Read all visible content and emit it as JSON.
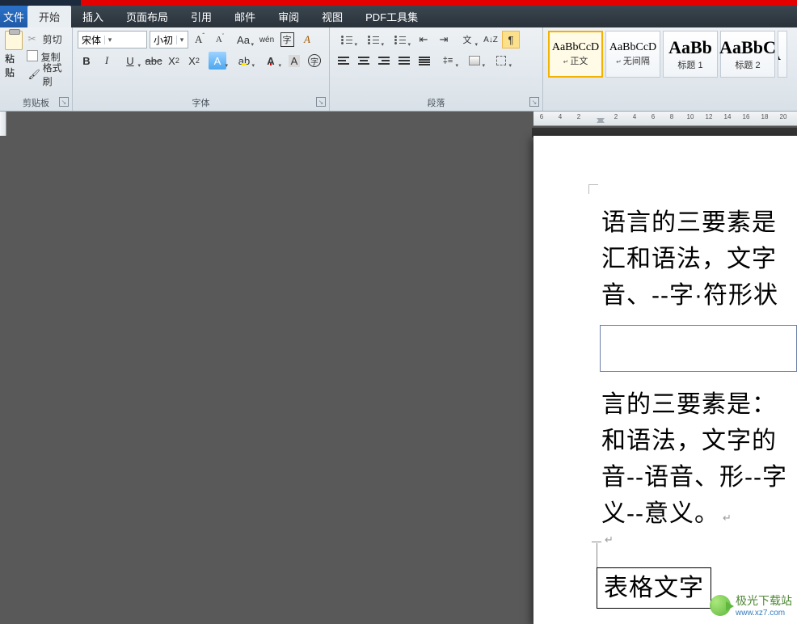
{
  "tabs": {
    "file": "文件",
    "home": "开始",
    "insert": "插入",
    "layout": "页面布局",
    "reference": "引用",
    "mail": "邮件",
    "review": "审阅",
    "view": "视图",
    "pdf": "PDF工具集"
  },
  "clipboard": {
    "group_label": "剪贴板",
    "paste": "粘贴",
    "cut": "剪切",
    "copy": "复制",
    "painter": "格式刷"
  },
  "font": {
    "group_label": "字体",
    "name": "宋体",
    "size": "小初"
  },
  "paragraph": {
    "group_label": "段落"
  },
  "styles": {
    "items": [
      {
        "preview": "AaBbCcD",
        "name": "正文",
        "sel": true,
        "big": false,
        "caret": true
      },
      {
        "preview": "AaBbCcD",
        "name": "无间隔",
        "sel": false,
        "big": false,
        "caret": true
      },
      {
        "preview": "AaBb",
        "name": "标题 1",
        "sel": false,
        "big": true,
        "caret": false
      },
      {
        "preview": "AaBbC",
        "name": "标题 2",
        "sel": false,
        "big": true,
        "caret": false
      }
    ]
  },
  "ruler": {
    "numbers": [
      6,
      4,
      2,
      "",
      2,
      4,
      6,
      8,
      10,
      12,
      14,
      16,
      18,
      20
    ]
  },
  "document": {
    "p1_l1": "语言的三要素是",
    "p1_l2": "汇和语法，文字",
    "p1_l3": "音、--字·符形状",
    "p2_l1": "言的三要素是：",
    "p2_l2": "和语法，文字的",
    "p2_l3": "音--语音、形--字",
    "p2_l4": "义--意义。",
    "return_mark": "↵",
    "table_cell": "表格文字"
  },
  "watermark": {
    "text": "极光下载站",
    "sub": "www.xz7.com"
  }
}
